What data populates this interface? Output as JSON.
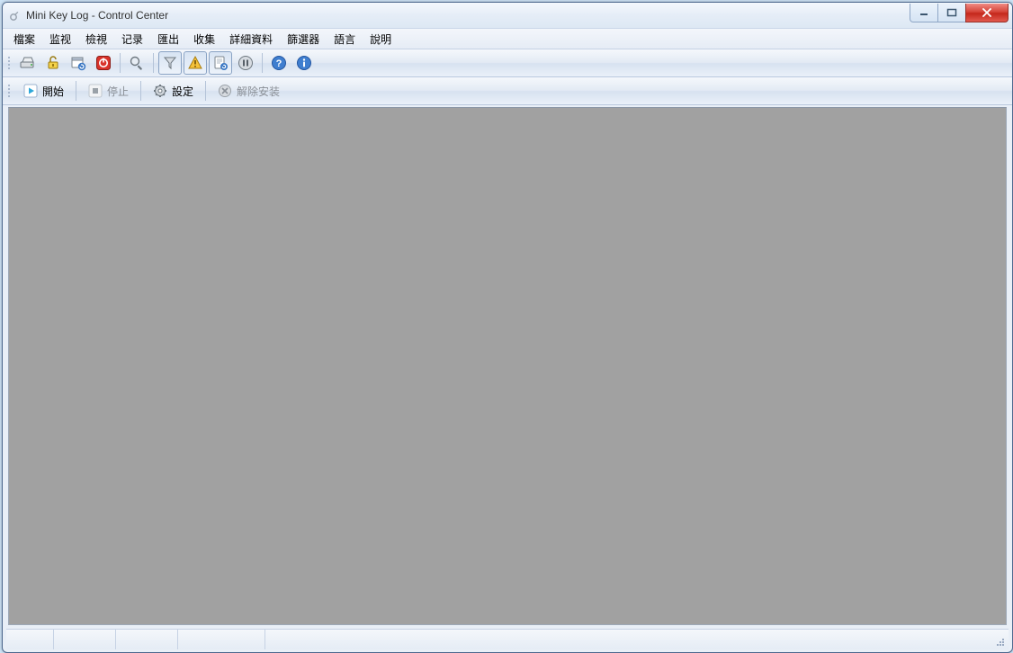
{
  "window": {
    "title": "Mini Key Log - Control Center"
  },
  "menu": {
    "items": [
      "檔案",
      "监视",
      "檢視",
      "记录",
      "匯出",
      "收集",
      "詳細資料",
      "篩選器",
      "語言",
      "說明"
    ]
  },
  "toolbar1": {
    "icons": [
      {
        "name": "drive-icon"
      },
      {
        "name": "unlock-icon"
      },
      {
        "name": "calendar-refresh-icon"
      },
      {
        "name": "power-icon"
      }
    ],
    "icons_group2": [
      {
        "name": "magnifier-icon"
      }
    ],
    "icons_group3": [
      {
        "name": "filter-icon",
        "pressed": true
      },
      {
        "name": "warning-icon",
        "pressed": true
      },
      {
        "name": "page-refresh-icon",
        "pressed": true
      },
      {
        "name": "pause-circle-icon"
      }
    ],
    "icons_group4": [
      {
        "name": "help-icon"
      },
      {
        "name": "info-icon"
      }
    ]
  },
  "toolbar2": {
    "start": {
      "label": "開始"
    },
    "stop": {
      "label": "停止",
      "disabled": true
    },
    "settings": {
      "label": "設定"
    },
    "uninstall": {
      "label": "解除安装",
      "disabled": true
    }
  }
}
